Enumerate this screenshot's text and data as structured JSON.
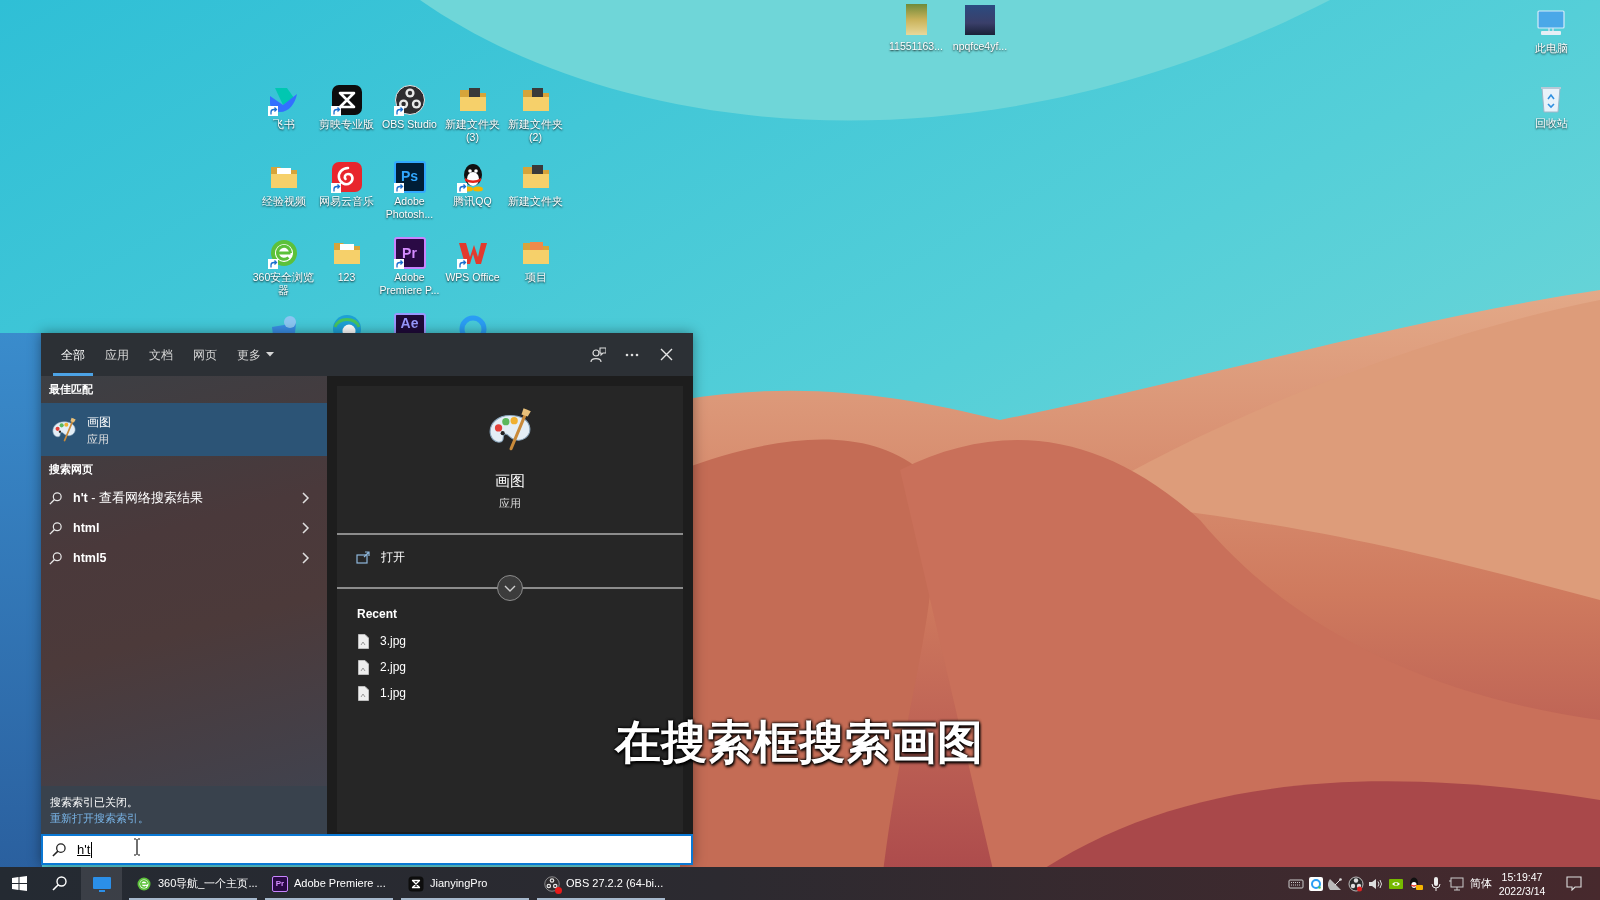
{
  "desktop": {
    "top_files": [
      {
        "label": "11551163..."
      },
      {
        "label": "npqfce4yf..."
      }
    ],
    "system_icons": [
      {
        "label": "此电脑"
      },
      {
        "label": "回收站"
      }
    ],
    "grid": [
      {
        "label": "飞书",
        "shortcut": true,
        "covered": false
      },
      {
        "label": "剪映专业版",
        "shortcut": true,
        "covered": false
      },
      {
        "label": "OBS Studio",
        "shortcut": true,
        "covered": false
      },
      {
        "label": "新建文件夹 (3)",
        "shortcut": false,
        "covered": false
      },
      {
        "label": "新建文件夹 (2)",
        "shortcut": false,
        "covered": false
      },
      {
        "label": "经验视频",
        "shortcut": false,
        "covered": false
      },
      {
        "label": "网易云音乐",
        "shortcut": true,
        "covered": false
      },
      {
        "label": "Adobe Photosh...",
        "logo_text": "Ps",
        "shortcut": true,
        "covered": false
      },
      {
        "label": "腾讯QQ",
        "shortcut": true,
        "covered": false
      },
      {
        "label": "新建文件夹",
        "shortcut": false,
        "covered": false
      },
      {
        "label": "360安全浏览器",
        "shortcut": true,
        "covered": false
      },
      {
        "label": "123",
        "shortcut": false,
        "covered": false
      },
      {
        "label": "Adobe Premiere P...",
        "logo_text": "Pr",
        "shortcut": true,
        "covered": false
      },
      {
        "label": "WPS Office",
        "shortcut": true,
        "covered": false
      },
      {
        "label": "项目",
        "shortcut": false,
        "covered": false
      },
      {
        "covered": true
      },
      {
        "covered": true
      },
      {
        "logo_text": "Ae",
        "covered": true
      },
      {
        "covered": true
      }
    ]
  },
  "search_panel": {
    "tabs": [
      {
        "label": "全部",
        "kind": "tab",
        "selected": true
      },
      {
        "label": "应用",
        "kind": "tab",
        "selected": false
      },
      {
        "label": "文档",
        "kind": "tab",
        "selected": false
      },
      {
        "label": "网页",
        "kind": "tab",
        "selected": false
      },
      {
        "label": "更多",
        "kind": "dropdown",
        "selected": false
      }
    ],
    "best_match": {
      "heading": "最佳匹配",
      "item": {
        "title": "画图",
        "subtitle": "应用",
        "selected": true
      }
    },
    "web": {
      "heading": "搜索网页",
      "items": [
        {
          "text": "**h't** - 查看网络搜索结果"
        },
        {
          "text": "**html**"
        },
        {
          "text": "**html5**"
        }
      ]
    },
    "footer": {
      "notice": "搜索索引已关闭。",
      "link": "重新打开搜索索引。"
    },
    "detail": {
      "title": "画图",
      "subtitle": "应用",
      "actions": [
        {
          "label": "打开"
        }
      ],
      "recent_heading": "Recent",
      "recent": [
        {
          "name": "3.jpg"
        },
        {
          "name": "2.jpg"
        },
        {
          "name": "1.jpg"
        }
      ]
    },
    "search_box": {
      "value": "h't"
    }
  },
  "caption": "在搜索框搜索画图",
  "taskbar": {
    "apps": [
      {
        "label": "360导航_一个主页...",
        "recording": false
      },
      {
        "label": "Adobe Premiere ...",
        "logo_text": "Pr",
        "recording": false
      },
      {
        "label": "JianyingPro",
        "recording": false
      },
      {
        "label": "OBS 27.2.2 (64-bi...",
        "recording": true
      }
    ],
    "ime": "简体",
    "time": "15:19:47",
    "date": "2022/3/14"
  }
}
